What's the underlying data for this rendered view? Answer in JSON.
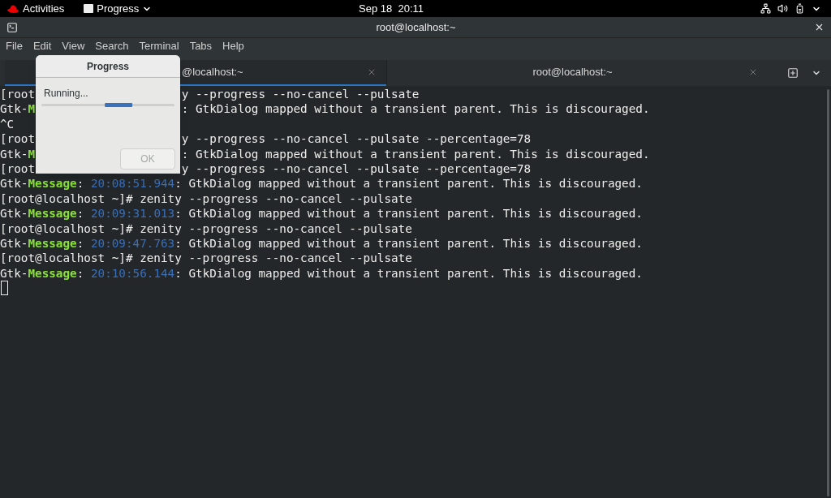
{
  "top_bar": {
    "activities": "Activities",
    "app_menu": "Progress",
    "clock": "Sep 18  20:11"
  },
  "window": {
    "title": "root@localhost:~"
  },
  "menu": [
    "File",
    "Edit",
    "View",
    "Search",
    "Terminal",
    "Tabs",
    "Help"
  ],
  "tabs": [
    {
      "label": "@localhost:~",
      "selected": true
    },
    {
      "label": "root@localhost:~",
      "selected": false
    }
  ],
  "terminal": {
    "lines": [
      {
        "left": [
          {
            "text": "[root",
            "kind": "plain"
          }
        ],
        "right": [
          {
            "text": "y --progress --no-cancel --pulsate",
            "kind": "plain"
          }
        ]
      },
      {
        "left": [
          {
            "text": "Gtk-",
            "kind": "plain"
          },
          {
            "text": "M",
            "kind": "label"
          }
        ],
        "right": [
          {
            "text": ": GtkDialog mapped without a transient parent. This is discouraged.",
            "kind": "plain"
          }
        ]
      },
      {
        "left": [
          {
            "text": "^C",
            "kind": "plain"
          }
        ]
      },
      {
        "left": [
          {
            "text": "[root",
            "kind": "plain"
          }
        ],
        "right": [
          {
            "text": "y --progress --no-cancel --pulsate --percentage=78",
            "kind": "plain"
          }
        ]
      },
      {
        "left": [
          {
            "text": "Gtk-",
            "kind": "plain"
          },
          {
            "text": "M",
            "kind": "label"
          }
        ],
        "right": [
          {
            "text": ": GtkDialog mapped without a transient parent. This is discouraged.",
            "kind": "plain"
          }
        ]
      },
      {
        "left": [
          {
            "text": "[root",
            "kind": "plain"
          }
        ],
        "right": [
          {
            "text": "y --progress --no-cancel --pulsate --percentage=78",
            "kind": "plain"
          }
        ]
      },
      {
        "segments": [
          {
            "text": "Gtk-",
            "kind": "plain"
          },
          {
            "text": "Message",
            "kind": "label"
          },
          {
            "text": ": ",
            "kind": "plain"
          },
          {
            "text": "20:08:51.944",
            "kind": "time"
          },
          {
            "text": ": GtkDialog mapped without a transient parent. This is discouraged.",
            "kind": "plain"
          }
        ]
      },
      {
        "segments": [
          {
            "text": "[root@localhost ~]# zenity --progress --no-cancel --pulsate",
            "kind": "plain"
          }
        ]
      },
      {
        "segments": [
          {
            "text": "Gtk-",
            "kind": "plain"
          },
          {
            "text": "Message",
            "kind": "label"
          },
          {
            "text": ": ",
            "kind": "plain"
          },
          {
            "text": "20:09:31.013",
            "kind": "time"
          },
          {
            "text": ": GtkDialog mapped without a transient parent. This is discouraged.",
            "kind": "plain"
          }
        ]
      },
      {
        "segments": [
          {
            "text": "[root@localhost ~]# zenity --progress --no-cancel --pulsate",
            "kind": "plain"
          }
        ]
      },
      {
        "segments": [
          {
            "text": "Gtk-",
            "kind": "plain"
          },
          {
            "text": "Message",
            "kind": "label"
          },
          {
            "text": ": ",
            "kind": "plain"
          },
          {
            "text": "20:09:47.763",
            "kind": "time"
          },
          {
            "text": ": GtkDialog mapped without a transient parent. This is discouraged.",
            "kind": "plain"
          }
        ]
      },
      {
        "segments": [
          {
            "text": "[root@localhost ~]# zenity --progress --no-cancel --pulsate",
            "kind": "plain"
          }
        ]
      },
      {
        "segments": [
          {
            "text": "Gtk-",
            "kind": "plain"
          },
          {
            "text": "Message",
            "kind": "label"
          },
          {
            "text": ": ",
            "kind": "plain"
          },
          {
            "text": "20:10:56.144",
            "kind": "time"
          },
          {
            "text": ": GtkDialog mapped without a transient parent. This is discouraged.",
            "kind": "plain"
          }
        ]
      }
    ]
  },
  "dialog": {
    "title": "Progress",
    "text": "Running...",
    "progress": {
      "level": 0.58
    },
    "ok": {
      "label": "OK",
      "disabled": true
    }
  }
}
